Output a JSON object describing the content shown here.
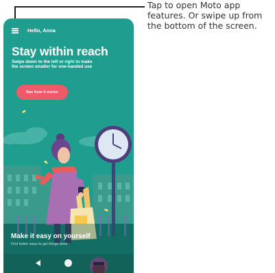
{
  "callout": {
    "lines": [
      "Tap to open Moto app",
      "features. Or swipe up from",
      "the bottom of the screen."
    ]
  },
  "app": {
    "greeting": "Hello, Anna",
    "hero": {
      "title": "Stay within reach",
      "subtitle_lines": [
        "Swipe down to the left or right to make",
        "the screen smaller for one-handed use"
      ],
      "button_label": "See how it works"
    },
    "card": {
      "title": "Make it easy on yourself",
      "subtitle": "Find better ways to get things done"
    }
  },
  "icons": {
    "menu": "menu-icon",
    "back": "back-icon",
    "home": "home-icon"
  },
  "colors": {
    "background_teal": "#1f9e90",
    "button_coral": "#ee5a6a",
    "callout_line": "#1f1f1f"
  }
}
